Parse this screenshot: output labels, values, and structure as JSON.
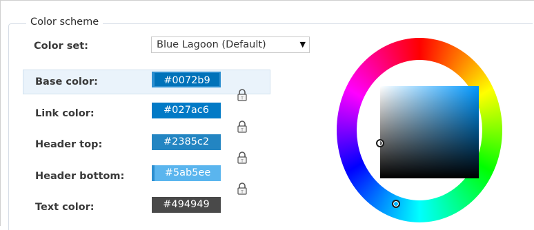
{
  "fieldset": {
    "legend": "Color scheme"
  },
  "color_set": {
    "label": "Color set:",
    "selected": "Blue Lagoon (Default)"
  },
  "fields": [
    {
      "label": "Base color:",
      "value": "#0072b9",
      "color": "#0072b9",
      "active": true
    },
    {
      "label": "Link color:",
      "value": "#027ac6",
      "color": "#027ac6",
      "active": false
    },
    {
      "label": "Header top:",
      "value": "#2385c2",
      "color": "#2385c2",
      "active": false
    },
    {
      "label": "Header bottom:",
      "value": "#5ab5ee",
      "color": "#5ab5ee",
      "active": false
    },
    {
      "label": "Text color:",
      "value": "#494949",
      "color": "#494949",
      "active": false
    }
  ],
  "icons": {
    "lock": "padlock-icon",
    "dropdown": "chevron-down-icon"
  }
}
